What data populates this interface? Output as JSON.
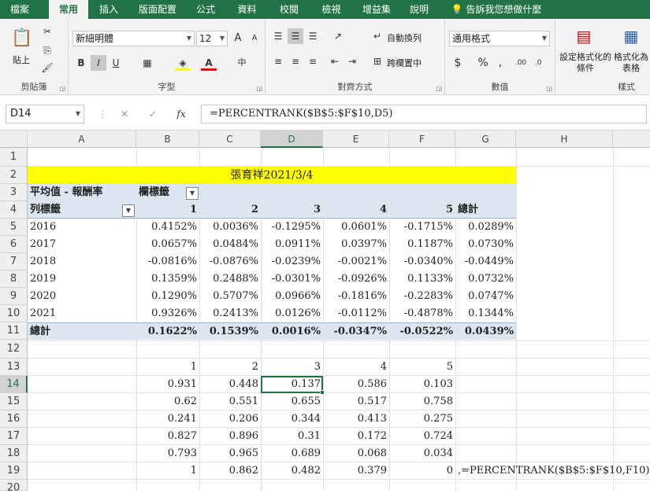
{
  "tabs": [
    "檔案",
    "常用",
    "插入",
    "版面配置",
    "公式",
    "資料",
    "校閱",
    "檢視",
    "增益集",
    "說明",
    "告訴我您想做什麼"
  ],
  "ribbon": {
    "clipboard": {
      "paste": "貼上",
      "label": "剪貼簿"
    },
    "font": {
      "name": "新細明體",
      "size": "12",
      "label": "字型",
      "bold": "B",
      "italic": "I",
      "underline": "U",
      "grow": "A",
      "shrink": "A"
    },
    "alignment": {
      "wrap": "自動換列",
      "merge": "跨欄置中",
      "label": "對齊方式"
    },
    "number": {
      "format": "通用格式",
      "label": "數值",
      "currency": "$",
      "percent": "%",
      "comma": ","
    },
    "styles": {
      "conditional": "設定格式化的條件",
      "as_table": "格式化為表格",
      "label": "樣式"
    }
  },
  "formula_bar": {
    "name_box": "D14",
    "fx": "fx",
    "formula": "=PERCENTRANK($B$5:$F$10,D5)"
  },
  "columns": [
    "A",
    "B",
    "C",
    "D",
    "E",
    "F",
    "G",
    "H"
  ],
  "rows": [
    "1",
    "2",
    "3",
    "4",
    "5",
    "6",
    "7",
    "8",
    "9",
    "10",
    "11",
    "12",
    "13",
    "14",
    "15",
    "16",
    "17",
    "18",
    "19",
    "20"
  ],
  "sheet": {
    "title": "張育祥2021/3/4",
    "pivot_value_label": "平均值 - 報酬率",
    "col_labels": "欄標籤",
    "row_labels": "列標籤",
    "pivot_cols": [
      "1",
      "2",
      "3",
      "4",
      "5"
    ],
    "grand_total": "總計",
    "pivot_rows": [
      {
        "year": "2016",
        "v": [
          "0.4152%",
          "0.0036%",
          "-0.1295%",
          "0.0601%",
          "-0.1715%",
          "0.0289%"
        ]
      },
      {
        "year": "2017",
        "v": [
          "0.0657%",
          "0.0484%",
          "0.0911%",
          "0.0397%",
          "0.1187%",
          "0.0730%"
        ]
      },
      {
        "year": "2018",
        "v": [
          "-0.0816%",
          "-0.0876%",
          "-0.0239%",
          "-0.0021%",
          "-0.0340%",
          "-0.0449%"
        ]
      },
      {
        "year": "2019",
        "v": [
          "0.1359%",
          "0.2488%",
          "-0.0301%",
          "-0.0926%",
          "0.1133%",
          "0.0732%"
        ]
      },
      {
        "year": "2020",
        "v": [
          "0.1290%",
          "0.5707%",
          "0.0966%",
          "-0.1816%",
          "-0.2283%",
          "0.0747%"
        ]
      },
      {
        "year": "2021",
        "v": [
          "0.9326%",
          "0.2413%",
          "0.0126%",
          "-0.0112%",
          "-0.4878%",
          "0.1344%"
        ]
      }
    ],
    "total_row": [
      "0.1622%",
      "0.1539%",
      "0.0016%",
      "-0.0347%",
      "-0.0522%",
      "0.0439%"
    ],
    "rank_header": [
      "1",
      "2",
      "3",
      "4",
      "5"
    ],
    "rank_rows": [
      [
        "0.931",
        "0.448",
        "0.137",
        "0.586",
        "0.103"
      ],
      [
        "0.62",
        "0.551",
        "0.655",
        "0.517",
        "0.758"
      ],
      [
        "0.241",
        "0.206",
        "0.344",
        "0.413",
        "0.275"
      ],
      [
        "0.827",
        "0.896",
        "0.31",
        "0.172",
        "0.724"
      ],
      [
        "0.793",
        "0.965",
        "0.689",
        "0.068",
        "0.034"
      ],
      [
        "1",
        "0.862",
        "0.482",
        "0.379",
        "0"
      ]
    ],
    "note": ",=PERCENTRANK($B$5:$F$10,F10)"
  },
  "colors": {
    "excel_green": "#217346",
    "title_fill": "#ffff00",
    "pivot_fill": "#dce6f1"
  }
}
